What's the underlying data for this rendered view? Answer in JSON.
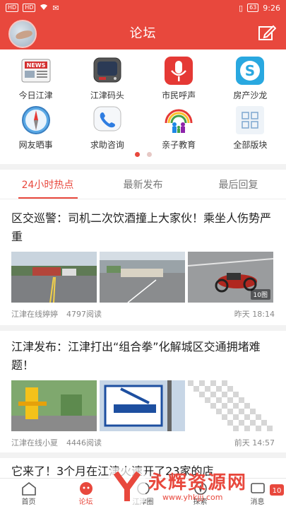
{
  "status": {
    "time": "9:26",
    "battery": "63",
    "left_badges": [
      "HD",
      "HD"
    ]
  },
  "header": {
    "title": "论坛"
  },
  "shortcuts": [
    {
      "label": "今日江津",
      "icon": "newspaper-icon"
    },
    {
      "label": "江津码头",
      "icon": "tv-icon"
    },
    {
      "label": "市民呼声",
      "icon": "microphone-icon"
    },
    {
      "label": "房产沙龙",
      "icon": "skype-icon"
    },
    {
      "label": "网友晒事",
      "icon": "compass-icon"
    },
    {
      "label": "求助咨询",
      "icon": "phone-icon"
    },
    {
      "label": "亲子教育",
      "icon": "family-icon"
    },
    {
      "label": "全部版块",
      "icon": "grid-icon"
    }
  ],
  "tabs": [
    {
      "label": "24小时热点",
      "active": true
    },
    {
      "label": "最新发布",
      "active": false
    },
    {
      "label": "最后回复",
      "active": false
    }
  ],
  "articles": [
    {
      "title": "区交巡警：司机二次饮酒撞上大家伙！乘坐人伤势严重",
      "author": "江津在线婷婷",
      "reads": "4797阅读",
      "time": "昨天 18:14",
      "image_count": "10图"
    },
    {
      "title": "江津发布：江津打出“组合拳”化解城区交通拥堵难题！",
      "author": "江津在线小夏",
      "reads": "4446阅读",
      "time": "前天 14:57"
    },
    {
      "title": "它来了！3个月在江津火速开了23家的店"
    }
  ],
  "bottom_nav": [
    {
      "label": "首页",
      "icon": "home-icon",
      "active": false
    },
    {
      "label": "论坛",
      "icon": "forum-icon",
      "active": true
    },
    {
      "label": "江津圈",
      "icon": "circle-icon",
      "active": false
    },
    {
      "label": "探索",
      "icon": "explore-icon",
      "active": false
    },
    {
      "label": "消息",
      "icon": "message-icon",
      "active": false
    }
  ],
  "watermark": {
    "text": "永辉资源网",
    "url": "www.yhkjjj.com",
    "badge": "10"
  },
  "colors": {
    "brand": "#e8483d",
    "tab_inactive": "#777777",
    "meta": "#888888"
  }
}
